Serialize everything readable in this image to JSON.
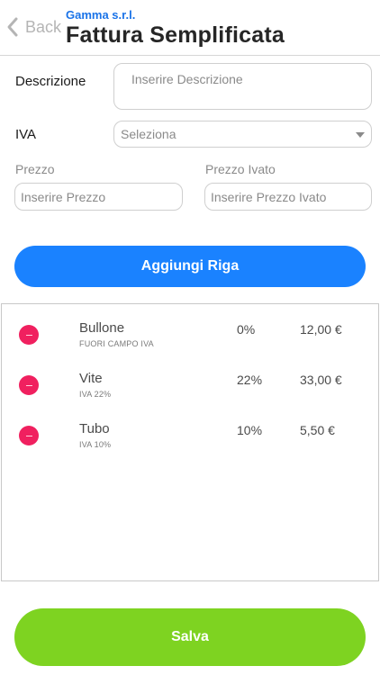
{
  "header": {
    "back_label": "Back",
    "company": "Gamma s.r.l.",
    "title": "Fattura Semplificata"
  },
  "form": {
    "descrizione_label": "Descrizione",
    "descrizione_placeholder": "Inserire Descrizione",
    "iva_label": "IVA",
    "iva_selected": "Seleziona",
    "prezzo_label": "Prezzo",
    "prezzo_placeholder": "Inserire Prezzo",
    "prezzo_ivato_label": "Prezzo Ivato",
    "prezzo_ivato_placeholder": "Inserire Prezzo Ivato",
    "add_button": "Aggiungi Riga"
  },
  "items": [
    {
      "name": "Bullone",
      "sub": "FUORI CAMPO IVA",
      "iva": "0%",
      "price": "12,00 €"
    },
    {
      "name": "Vite",
      "sub": "IVA 22%",
      "iva": "22%",
      "price": "33,00 €"
    },
    {
      "name": "Tubo",
      "sub": "IVA 10%",
      "iva": "10%",
      "price": "5,50 €"
    }
  ],
  "save_button": "Salva",
  "colors": {
    "accent_blue": "#1a82ff",
    "company_blue": "#1a73e8",
    "save_green": "#7ed321",
    "delete_pink": "#f0205f"
  }
}
